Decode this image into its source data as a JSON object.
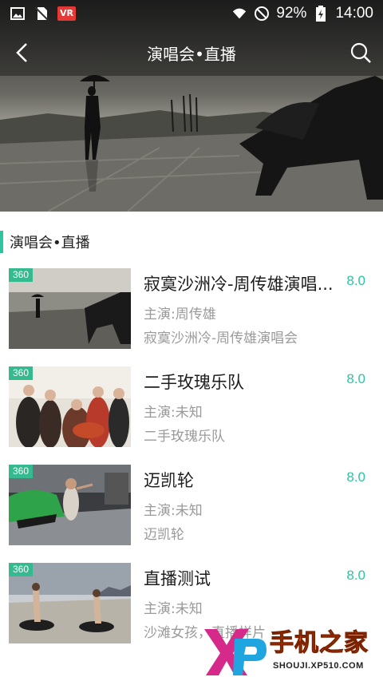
{
  "status_bar": {
    "battery": "92%",
    "time": "14:00",
    "left_icons": [
      "image-icon",
      "no-sim-icon",
      "vr-icon"
    ],
    "vr_label": "VR",
    "right_icons": [
      "wifi-icon",
      "do-not-disturb-icon",
      "battery-charging-icon"
    ]
  },
  "nav": {
    "title": "演唱会•直播",
    "back_icon": "chevron-left-icon",
    "search_icon": "search-icon"
  },
  "section": {
    "title": "演唱会•直播",
    "accent": "#2ec4a0"
  },
  "items": [
    {
      "badge": "360",
      "title": "寂寞沙洲冷-周传雄演唱...",
      "score": "8.0",
      "actor": "主演:周传雄",
      "desc": "寂寞沙洲冷-周传雄演唱会"
    },
    {
      "badge": "360",
      "title": "二手玫瑰乐队",
      "score": "8.0",
      "actor": "主演:未知",
      "desc": "二手玫瑰乐队"
    },
    {
      "badge": "360",
      "title": "迈凯轮",
      "score": "8.0",
      "actor": "主演:未知",
      "desc": "迈凯轮"
    },
    {
      "badge": "360",
      "title": "直播测试",
      "score": "8.0",
      "actor": "主演:未知",
      "desc": "沙滩女孩，直播样片"
    }
  ],
  "watermark": {
    "text": "手机之家",
    "url": "SHOUJI.XP510.COM"
  },
  "colors": {
    "accent": "#2ec4a0",
    "badge": "#35b98e",
    "watermark": "#ff5a00"
  }
}
